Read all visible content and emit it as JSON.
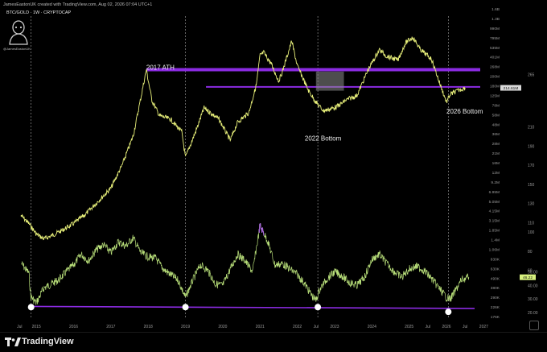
{
  "header": {
    "author_line": "JamesEastonUK created with TradingView.com, Aug 02, 2026 07:04 UTC+1",
    "symbol_line": "BTC/GOLD · 1W · CRYPTOCAP",
    "avatar_label": "@JamesEastonUK"
  },
  "footer": {
    "brand": "TradingView",
    "corner_button": "⛶"
  },
  "colors": {
    "price_line": "#e8f07a",
    "oscillator_line": "#b9e07a",
    "oscillator_peak": "#a566d6",
    "support": "#8b2be2",
    "price_label_bg": "#d9d9d9",
    "osc_label_bg": "#d7f07e"
  },
  "annotations": [
    {
      "text": "2017 ATH",
      "t": 2017.95,
      "v": 270
    },
    {
      "text": "2022 Bottom",
      "t": 2022.2,
      "v": 196
    },
    {
      "text": "2026 Bottom",
      "t": 2026.0,
      "v": 224
    }
  ],
  "chart_data": [
    {
      "type": "line",
      "title": "BTC/GOLD",
      "x_ticks": [
        "Jul",
        "2015",
        "2016",
        "2017",
        "2018",
        "2019",
        "2020",
        "2021",
        "2022",
        "Jul",
        "2023",
        "2024",
        "2025",
        "Jul",
        "2026",
        "Jul",
        "2027"
      ],
      "x_range": [
        2014.5,
        2027.1
      ],
      "right_axis_ticks": [
        "265",
        "210",
        "190",
        "170",
        "150",
        "130",
        "110",
        "100",
        "80",
        "60",
        "50",
        "40",
        "30",
        "20"
      ],
      "left_axis_ticks": [
        "1.6B",
        "1.3B",
        "990M",
        "795M",
        "535M",
        "401M",
        "268M",
        "200M",
        "180M",
        "125M",
        "78M",
        "58M",
        "48M",
        "36M",
        "28M",
        "21M",
        "16M",
        "12M",
        "9.2M",
        "6.95M",
        "5.05M",
        "4.15M",
        "3.15M",
        "1.85M",
        "1.4M",
        "1.06M",
        "830K",
        "630K",
        "490K",
        "380K",
        "290K",
        "226K",
        "176K"
      ],
      "last_value_label": "214.61M",
      "series": [
        {
          "t": [
            2014.6,
            2014.8,
            2015.0,
            2015.2,
            2015.4,
            2015.7,
            2016.0,
            2016.3,
            2016.6,
            2017.0,
            2017.3,
            2017.6,
            2017.8,
            2017.95,
            2018.1,
            2018.3,
            2018.6,
            2018.9,
            2019.0,
            2019.3,
            2019.5,
            2019.7,
            2019.9,
            2020.2,
            2020.4,
            2020.7,
            2020.9,
            2021.0,
            2021.1,
            2021.3,
            2021.5,
            2021.6,
            2021.85,
            2022.0,
            2022.3,
            2022.5,
            2022.7,
            2022.9,
            2023.1,
            2023.3,
            2023.6,
            2023.9,
            2024.2,
            2024.4,
            2024.7,
            2024.9,
            2025.1,
            2025.3,
            2025.6,
            2025.8,
            2026.0,
            2026.1,
            2026.3,
            2026.5
          ],
          "v": [
            117,
            109,
            98,
            93,
            96,
            102,
            109,
            118,
            130,
            146,
            170,
            201,
            240,
            270,
            238,
            222,
            218,
            205,
            178,
            208,
            230,
            224,
            218,
            196,
            215,
            225,
            254,
            285,
            288,
            276,
            258,
            268,
            300,
            274,
            248,
            236,
            227,
            229,
            232,
            238,
            243,
            270,
            291,
            284,
            280,
            298,
            304,
            291,
            281,
            258,
            236,
            244,
            248,
            251
          ]
        }
      ],
      "sub_chart": {
        "type": "line",
        "right_axis_ticks": [
          "50.00",
          "40.00",
          "30.00",
          "20.00"
        ],
        "last_value_label": "46.22",
        "series": [
          {
            "t": [
              2014.6,
              2014.8,
              2014.85,
              2015.0,
              2015.2,
              2015.4,
              2015.6,
              2015.8,
              2016.0,
              2016.2,
              2016.4,
              2016.6,
              2016.8,
              2017.0,
              2017.2,
              2017.4,
              2017.6,
              2017.8,
              2018.0,
              2018.2,
              2018.4,
              2018.6,
              2018.8,
              2019.0,
              2019.2,
              2019.4,
              2019.6,
              2019.8,
              2020.0,
              2020.2,
              2020.4,
              2020.6,
              2020.8,
              2021.0,
              2021.2,
              2021.4,
              2021.6,
              2021.8,
              2022.0,
              2022.2,
              2022.4,
              2022.5,
              2022.6,
              2022.8,
              2023.0,
              2023.2,
              2023.4,
              2023.6,
              2023.8,
              2024.0,
              2024.2,
              2024.4,
              2024.6,
              2024.8,
              2025.0,
              2025.2,
              2025.4,
              2025.6,
              2025.8,
              2026.0,
              2026.1,
              2026.2,
              2026.4,
              2026.6
            ],
            "v": [
              56,
              49,
              32,
              27,
              38,
              41,
              44,
              50,
              55,
              63,
              58,
              66,
              70,
              64,
              72,
              69,
              75,
              64,
              61,
              60,
              52,
              48,
              44,
              31,
              44,
              55,
              51,
              41,
              40,
              52,
              63,
              58,
              50,
              84,
              73,
              55,
              56,
              52,
              48,
              41,
              32,
              29,
              37,
              45,
              50,
              47,
              42,
              40,
              46,
              59,
              63,
              56,
              50,
              46,
              52,
              54,
              51,
              45,
              38,
              31,
              30,
              34,
              44,
              46
            ]
          }
        ]
      }
    }
  ]
}
